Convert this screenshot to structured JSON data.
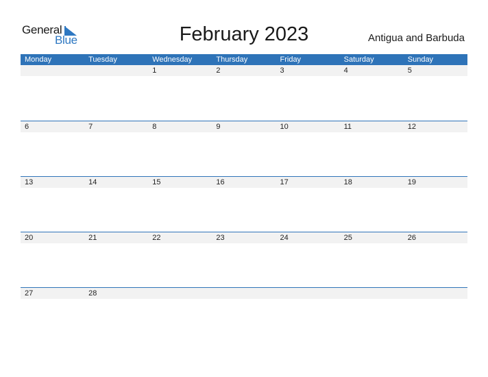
{
  "logo": {
    "general": "General",
    "blue": "Blue",
    "icon": "triangle-flag-icon"
  },
  "title": "February 2023",
  "country": "Antigua and Barbuda",
  "colors": {
    "header_bg": "#2e73b8",
    "strip_bg": "#f2f2f2",
    "logo_blue": "#2e78c2"
  },
  "weekdays": [
    "Monday",
    "Tuesday",
    "Wednesday",
    "Thursday",
    "Friday",
    "Saturday",
    "Sunday"
  ],
  "weeks": [
    [
      "",
      "",
      "1",
      "2",
      "3",
      "4",
      "5"
    ],
    [
      "6",
      "7",
      "8",
      "9",
      "10",
      "11",
      "12"
    ],
    [
      "13",
      "14",
      "15",
      "16",
      "17",
      "18",
      "19"
    ],
    [
      "20",
      "21",
      "22",
      "23",
      "24",
      "25",
      "26"
    ],
    [
      "27",
      "28",
      "",
      "",
      "",
      "",
      ""
    ]
  ]
}
